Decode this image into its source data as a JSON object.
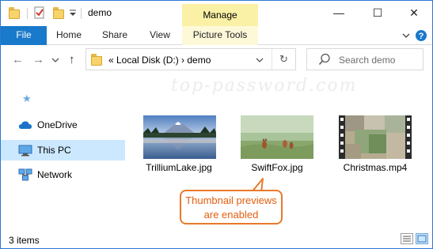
{
  "titlebar": {
    "title": "demo",
    "context_tab": "Manage",
    "minimize_glyph": "—",
    "maximize_glyph": "☐",
    "close_glyph": "✕"
  },
  "ribbon": {
    "tabs": [
      {
        "label": "File"
      },
      {
        "label": "Home"
      },
      {
        "label": "Share"
      },
      {
        "label": "View"
      },
      {
        "label": "Picture Tools"
      }
    ],
    "accent_color": "#1979ca",
    "context_color": "#faf1a6"
  },
  "address": {
    "prefix": "«",
    "path": [
      "Local Disk (D:)",
      "demo"
    ],
    "separator": "›",
    "full_text": "«  Local Disk (D:)  ›  demo"
  },
  "search": {
    "placeholder": "Search demo"
  },
  "nav": {
    "items": [
      {
        "label": "OneDrive",
        "icon": "cloud-icon"
      },
      {
        "label": "This PC",
        "icon": "computer-icon",
        "selected": true
      },
      {
        "label": "Network",
        "icon": "network-icon"
      }
    ]
  },
  "watermark": "top-password.com",
  "files": [
    {
      "name": "TrilliumLake.jpg",
      "type": "image"
    },
    {
      "name": "SwiftFox.jpg",
      "type": "image"
    },
    {
      "name": "Christmas.mp4",
      "type": "video"
    }
  ],
  "callout": {
    "line1": "Thumbnail previews",
    "line2": "are enabled",
    "color": "#e87a2a"
  },
  "status": {
    "item_count": "3 items"
  }
}
